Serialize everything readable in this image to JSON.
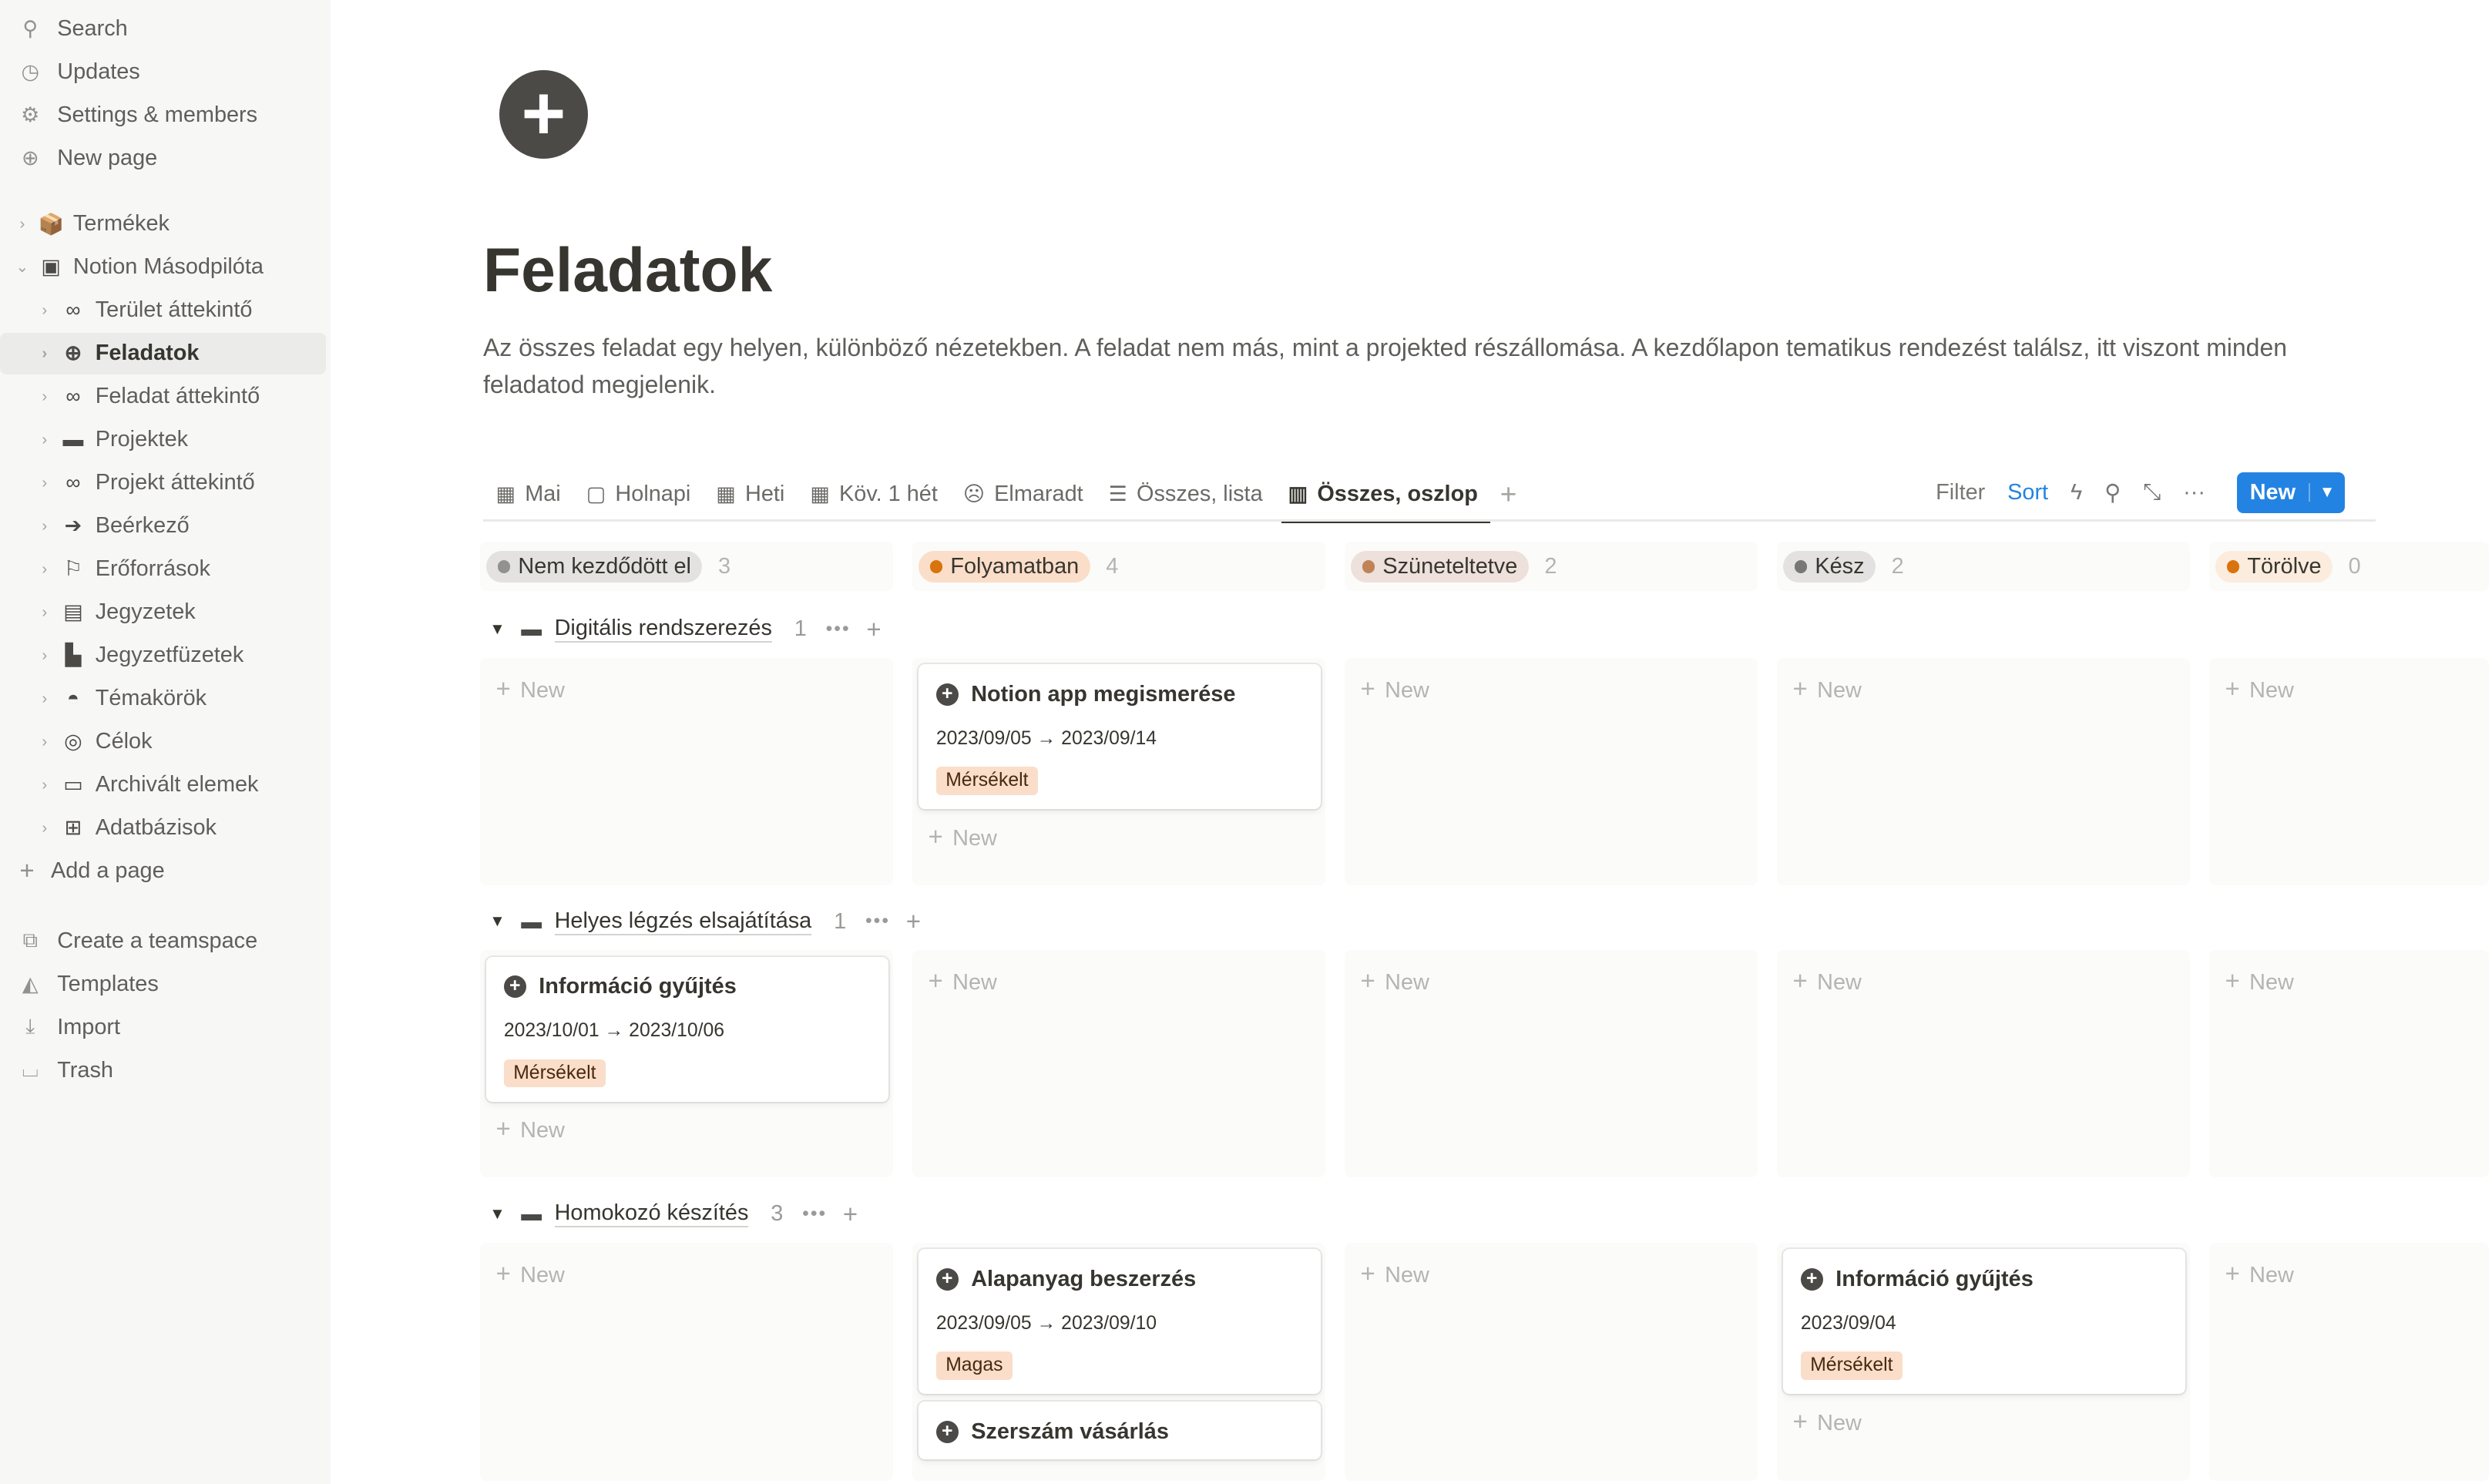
{
  "sidebar": {
    "top": [
      {
        "icon": "search-icon",
        "glyph": "⚲",
        "label": "Search"
      },
      {
        "icon": "clock-icon",
        "glyph": "◷",
        "label": "Updates"
      },
      {
        "icon": "gear-icon",
        "glyph": "⚙",
        "label": "Settings & members"
      },
      {
        "icon": "plus-circle-icon",
        "glyph": "⊕",
        "label": "New page"
      }
    ],
    "pages": [
      {
        "icon": "box-icon",
        "glyph": "📦",
        "label": "Termékek",
        "level": 0,
        "chev": "›"
      },
      {
        "icon": "chip-icon",
        "glyph": "▣",
        "label": "Notion Másodpilóta",
        "level": 0,
        "chev": "⌄"
      },
      {
        "icon": "binoculars-icon",
        "glyph": "∞",
        "label": "Terület áttekintő",
        "level": 1,
        "chev": "›"
      },
      {
        "icon": "plus-circle-icon",
        "glyph": "⊕",
        "label": "Feladatok",
        "level": 1,
        "chev": "›",
        "active": true
      },
      {
        "icon": "binoculars-icon",
        "glyph": "∞",
        "label": "Feladat áttekintő",
        "level": 1,
        "chev": "›"
      },
      {
        "icon": "folder-icon",
        "glyph": "▬",
        "label": "Projektek",
        "level": 1,
        "chev": "›"
      },
      {
        "icon": "binoculars-icon",
        "glyph": "∞",
        "label": "Projekt áttekintő",
        "level": 1,
        "chev": "›"
      },
      {
        "icon": "arrow-circle-icon",
        "glyph": "➔",
        "label": "Beérkező",
        "level": 1,
        "chev": "›"
      },
      {
        "icon": "bookmark-icon",
        "glyph": "⚐",
        "label": "Erőforrások",
        "level": 1,
        "chev": "›"
      },
      {
        "icon": "notes-icon",
        "glyph": "▤",
        "label": "Jegyzetek",
        "level": 1,
        "chev": "›"
      },
      {
        "icon": "notebook-icon",
        "glyph": "▙",
        "label": "Jegyzetfüzetek",
        "level": 1,
        "chev": "›"
      },
      {
        "icon": "leaf-icon",
        "glyph": "◓",
        "label": "Témakörök",
        "level": 1,
        "chev": "›"
      },
      {
        "icon": "target-icon",
        "glyph": "◎",
        "label": "Célok",
        "level": 1,
        "chev": "›"
      },
      {
        "icon": "archive-icon",
        "glyph": "▭",
        "label": "Archivált elemek",
        "level": 1,
        "chev": "›"
      },
      {
        "icon": "database-icon",
        "glyph": "⊞",
        "label": "Adatbázisok",
        "level": 1,
        "chev": "›"
      }
    ],
    "add_page": "Add a page",
    "bottom": [
      {
        "icon": "teamspace-icon",
        "glyph": "⧉",
        "label": "Create a teamspace"
      },
      {
        "icon": "templates-icon",
        "glyph": "◭",
        "label": "Templates"
      },
      {
        "icon": "import-icon",
        "glyph": "⤓",
        "label": "Import"
      },
      {
        "icon": "trash-icon",
        "glyph": "⌴",
        "label": "Trash"
      }
    ]
  },
  "page": {
    "icon": "+",
    "title": "Feladatok",
    "description": "Az összes feladat egy helyen, különböző nézetekben. A feladat nem más, mint a projekted részállomása. A kezdőlapon tematikus rendezést találsz, itt viszont minden feladatod megjelenik."
  },
  "tabs": [
    {
      "icon": "calendar-icon",
      "glyph": "▦",
      "label": "Mai"
    },
    {
      "icon": "calendar-icon",
      "glyph": "▢",
      "label": "Holnapi"
    },
    {
      "icon": "calendar-icon",
      "glyph": "▦",
      "label": "Heti"
    },
    {
      "icon": "calendar-icon",
      "glyph": "▦",
      "label": "Köv. 1 hét"
    },
    {
      "icon": "sad-face-icon",
      "glyph": "☹",
      "label": "Elmaradt"
    },
    {
      "icon": "list-icon",
      "glyph": "☰",
      "label": "Összes, lista"
    },
    {
      "icon": "columns-icon",
      "glyph": "▥",
      "label": "Összes, oszlop",
      "active": true
    }
  ],
  "actions": {
    "filter": "Filter",
    "sort": "Sort",
    "new": "New",
    "accent": "#2383e2"
  },
  "columns": [
    {
      "label": "Nem kezdődött el",
      "count": "3",
      "dot": "#91918e",
      "bg": "#e3e2e0"
    },
    {
      "label": "Folyamatban",
      "count": "4",
      "dot": "#d9730d",
      "bg": "#fadec9"
    },
    {
      "label": "Szüneteltetve",
      "count": "2",
      "dot": "#c08257",
      "bg": "#eee0da"
    },
    {
      "label": "Kész",
      "count": "2",
      "dot": "#787774",
      "bg": "#e3e2e0"
    },
    {
      "label": "Törölve",
      "count": "0",
      "dot": "#d9730d",
      "bg": "#fbecdd"
    }
  ],
  "new_label": "New",
  "groups": [
    {
      "name": "Digitális rendszerezés",
      "count": "1",
      "cells": [
        {
          "cards": [],
          "new": true
        },
        {
          "cards": [
            {
              "title": "Notion app megismerése",
              "date": "2023/09/05 → 2023/09/14",
              "tag": "Mérsékelt",
              "tagbg": "#fadec9"
            }
          ],
          "new": true
        },
        {
          "cards": [],
          "new": true
        },
        {
          "cards": [],
          "new": true
        },
        {
          "cards": [],
          "new": true
        }
      ]
    },
    {
      "name": "Helyes légzés elsajátítása",
      "count": "1",
      "cells": [
        {
          "cards": [
            {
              "title": "Információ gyűjtés",
              "date": "2023/10/01 → 2023/10/06",
              "tag": "Mérsékelt",
              "tagbg": "#fadec9"
            }
          ],
          "new": true
        },
        {
          "cards": [],
          "new": true
        },
        {
          "cards": [],
          "new": true
        },
        {
          "cards": [],
          "new": true
        },
        {
          "cards": [],
          "new": true
        }
      ]
    },
    {
      "name": "Homokozó készítés",
      "count": "3",
      "cells": [
        {
          "cards": [],
          "new": true
        },
        {
          "cards": [
            {
              "title": "Alapanyag beszerzés",
              "date": "2023/09/05 → 2023/09/10",
              "tag": "Magas",
              "tagbg": "#fadec9"
            },
            {
              "title": "Szerszám vásárlás",
              "date": "",
              "tag": ""
            }
          ],
          "new": false
        },
        {
          "cards": [],
          "new": true
        },
        {
          "cards": [
            {
              "title": "Információ gyűjtés",
              "date": "2023/09/04",
              "tag": "Mérsékelt",
              "tagbg": "#fadec9"
            }
          ],
          "new": true
        },
        {
          "cards": [],
          "new": true
        }
      ]
    }
  ]
}
